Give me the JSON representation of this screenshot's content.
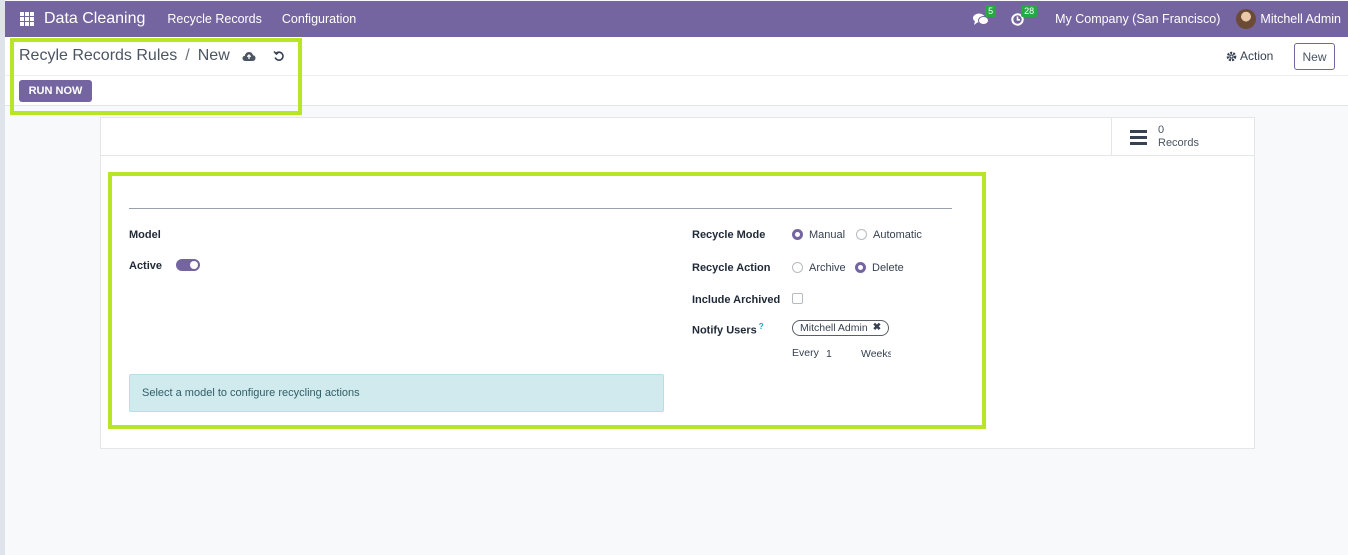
{
  "navbar": {
    "app_name": "Data Cleaning",
    "menu": [
      {
        "label": "Recycle Records"
      },
      {
        "label": "Configuration"
      }
    ],
    "messages_count": "5",
    "activities_count": "28",
    "company": "My Company (San Francisco)",
    "user": "Mitchell Admin",
    "accent_color": "#7465a0"
  },
  "control_panel": {
    "breadcrumb_parent": "Recyle Records Rules",
    "breadcrumb_separator": "/",
    "breadcrumb_current": "New",
    "run_now_label": "RUN NOW",
    "action_label": "Action",
    "new_label": "New",
    "highlight_color": "#b9e528"
  },
  "smart_button": {
    "count": "0",
    "label": "Records"
  },
  "form": {
    "model_label": "Model",
    "active_label": "Active",
    "active_value": true,
    "recycle_mode_label": "Recycle Mode",
    "recycle_mode_options": [
      {
        "label": "Manual",
        "selected": true
      },
      {
        "label": "Automatic",
        "selected": false
      }
    ],
    "recycle_action_label": "Recycle Action",
    "recycle_action_options": [
      {
        "label": "Archive",
        "selected": false
      },
      {
        "label": "Delete",
        "selected": true
      }
    ],
    "include_archived_label": "Include Archived",
    "include_archived_value": false,
    "notify_users_label": "Notify Users",
    "notify_users_help": "?",
    "notify_users_tag": "Mitchell Admin",
    "every_label": "Every",
    "every_value": "1",
    "every_unit": "Weeks",
    "info_message": "Select a model to configure recycling actions"
  }
}
